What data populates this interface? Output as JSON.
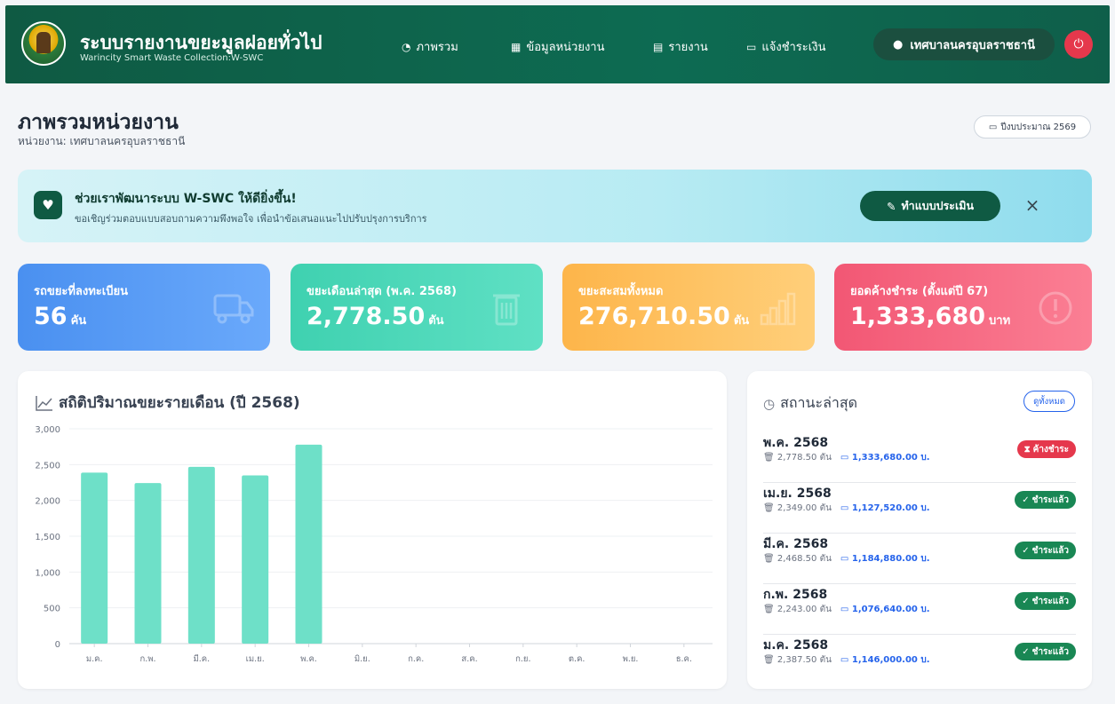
{
  "header": {
    "title": "ระบบรายงานขยะมูลฝอยทั่วไป",
    "subtitle": "Warincity Smart Waste Collection:W-SWC",
    "nav": [
      {
        "label": "ภาพรวม",
        "icon": "dashboard-icon"
      },
      {
        "label": "ข้อมูลหน่วยงาน",
        "icon": "building-icon"
      },
      {
        "label": "รายงาน",
        "icon": "report-icon"
      },
      {
        "label": "แจ้งชำระเงิน",
        "icon": "wallet-icon"
      }
    ],
    "user": "เทศบาลนครอุบลราชธานี"
  },
  "page": {
    "title": "ภาพรวมหน่วยงาน",
    "subtitle": "หน่วยงาน: เทศบาลนครอุบลราชธานี",
    "fiscal_year": "ปีงบประมาณ 2569"
  },
  "banner": {
    "title": "ช่วยเราพัฒนาระบบ W-SWC ให้ดียิ่งขึ้น!",
    "desc": "ขอเชิญร่วมตอบแบบสอบถามความพึงพอใจ เพื่อนำข้อเสนอแนะไปปรับปรุงการบริการ",
    "button": "ทำแบบประเมิน",
    "close": "×"
  },
  "stats": [
    {
      "label": "รถขยะที่ลงทะเบียน",
      "value": "56",
      "unit": "คัน",
      "icon": "truck-icon",
      "color": "#4a90f0"
    },
    {
      "label": "ขยะเดือนล่าสุด (พ.ค. 2568)",
      "value": "2,778.50",
      "unit": "ตัน",
      "icon": "trash-icon",
      "color": "#3fd1b0"
    },
    {
      "label": "ขยะสะสมทั้งหมด",
      "value": "276,710.50",
      "unit": "ตัน",
      "icon": "bar-chart-icon",
      "color": "#fdb54a"
    },
    {
      "label": "ยอดค้างชำระ (ตั้งแต่ปี 67)",
      "value": "1,333,680",
      "unit": "บาท",
      "icon": "alert-circle-icon",
      "color": "#f25774"
    }
  ],
  "chart_title": "สถิติปริมาณขยะรายเดือน (ปี 2568)",
  "chart_data": {
    "type": "bar",
    "title": "สถิติปริมาณขยะรายเดือน (ปี 2568)",
    "categories": [
      "ม.ค.",
      "ก.พ.",
      "มี.ค.",
      "เม.ย.",
      "พ.ค.",
      "มิ.ย.",
      "ก.ค.",
      "ส.ค.",
      "ก.ย.",
      "ต.ค.",
      "พ.ย.",
      "ธ.ค."
    ],
    "values": [
      2387.5,
      2243,
      2468.5,
      2349,
      2778.5,
      0,
      0,
      0,
      0,
      0,
      0,
      0
    ],
    "ylim": [
      0,
      3000
    ],
    "yticks": [
      "0",
      "500",
      "1,000",
      "1,500",
      "2,000",
      "2,500",
      "3,000"
    ],
    "xlabel": "",
    "ylabel": "",
    "grid": true,
    "bar_color": "#6ee0c8"
  },
  "status": {
    "title": "สถานะล่าสุด",
    "all_button": "ดูทั้งหมด",
    "rows": [
      {
        "month": "พ.ค. 2568",
        "weight": "2,778.50 ตัน",
        "amount": "1,333,680.00 บ.",
        "status": "ค้างชำระ",
        "state": "unpaid"
      },
      {
        "month": "เม.ย. 2568",
        "weight": "2,349.00 ตัน",
        "amount": "1,127,520.00 บ.",
        "status": "ชำระแล้ว",
        "state": "paid"
      },
      {
        "month": "มี.ค. 2568",
        "weight": "2,468.50 ตัน",
        "amount": "1,184,880.00 บ.",
        "status": "ชำระแล้ว",
        "state": "paid"
      },
      {
        "month": "ก.พ. 2568",
        "weight": "2,243.00 ตัน",
        "amount": "1,076,640.00 บ.",
        "status": "ชำระแล้ว",
        "state": "paid"
      },
      {
        "month": "ม.ค. 2568",
        "weight": "2,387.50 ตัน",
        "amount": "1,146,000.00 บ.",
        "status": "ชำระแล้ว",
        "state": "paid"
      }
    ]
  }
}
